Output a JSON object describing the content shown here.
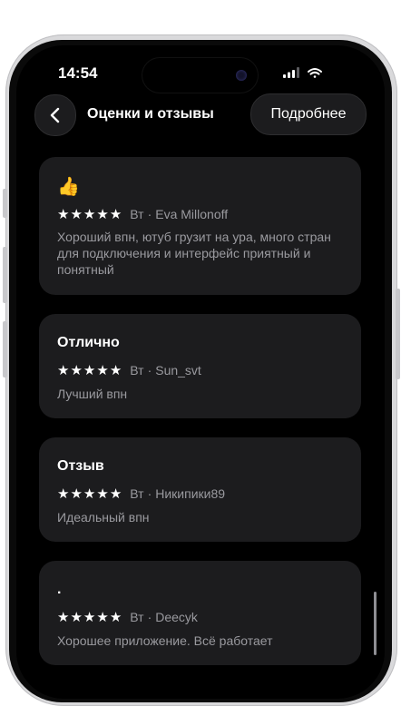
{
  "status_bar": {
    "time": "14:54"
  },
  "header": {
    "title": "Оценки и отзывы",
    "more_label": "Подробнее"
  },
  "reviews": [
    {
      "title": "👍",
      "rating": 5,
      "date": "Вт",
      "author": "Eva Millonoff",
      "body": "Хороший впн, ютуб грузит на ура, много стран для подключения и интерфейс приятный и понятный"
    },
    {
      "title": "Отлично",
      "rating": 5,
      "date": "Вт",
      "author": "Sun_svt",
      "body": "Лучший впн"
    },
    {
      "title": "Отзыв",
      "rating": 5,
      "date": "Вт",
      "author": "Никипики89",
      "body": "Идеальный впн"
    },
    {
      "title": ".",
      "rating": 5,
      "date": "Вт",
      "author": "Deecyk",
      "body": "Хорошее приложение. Всё работает"
    }
  ]
}
